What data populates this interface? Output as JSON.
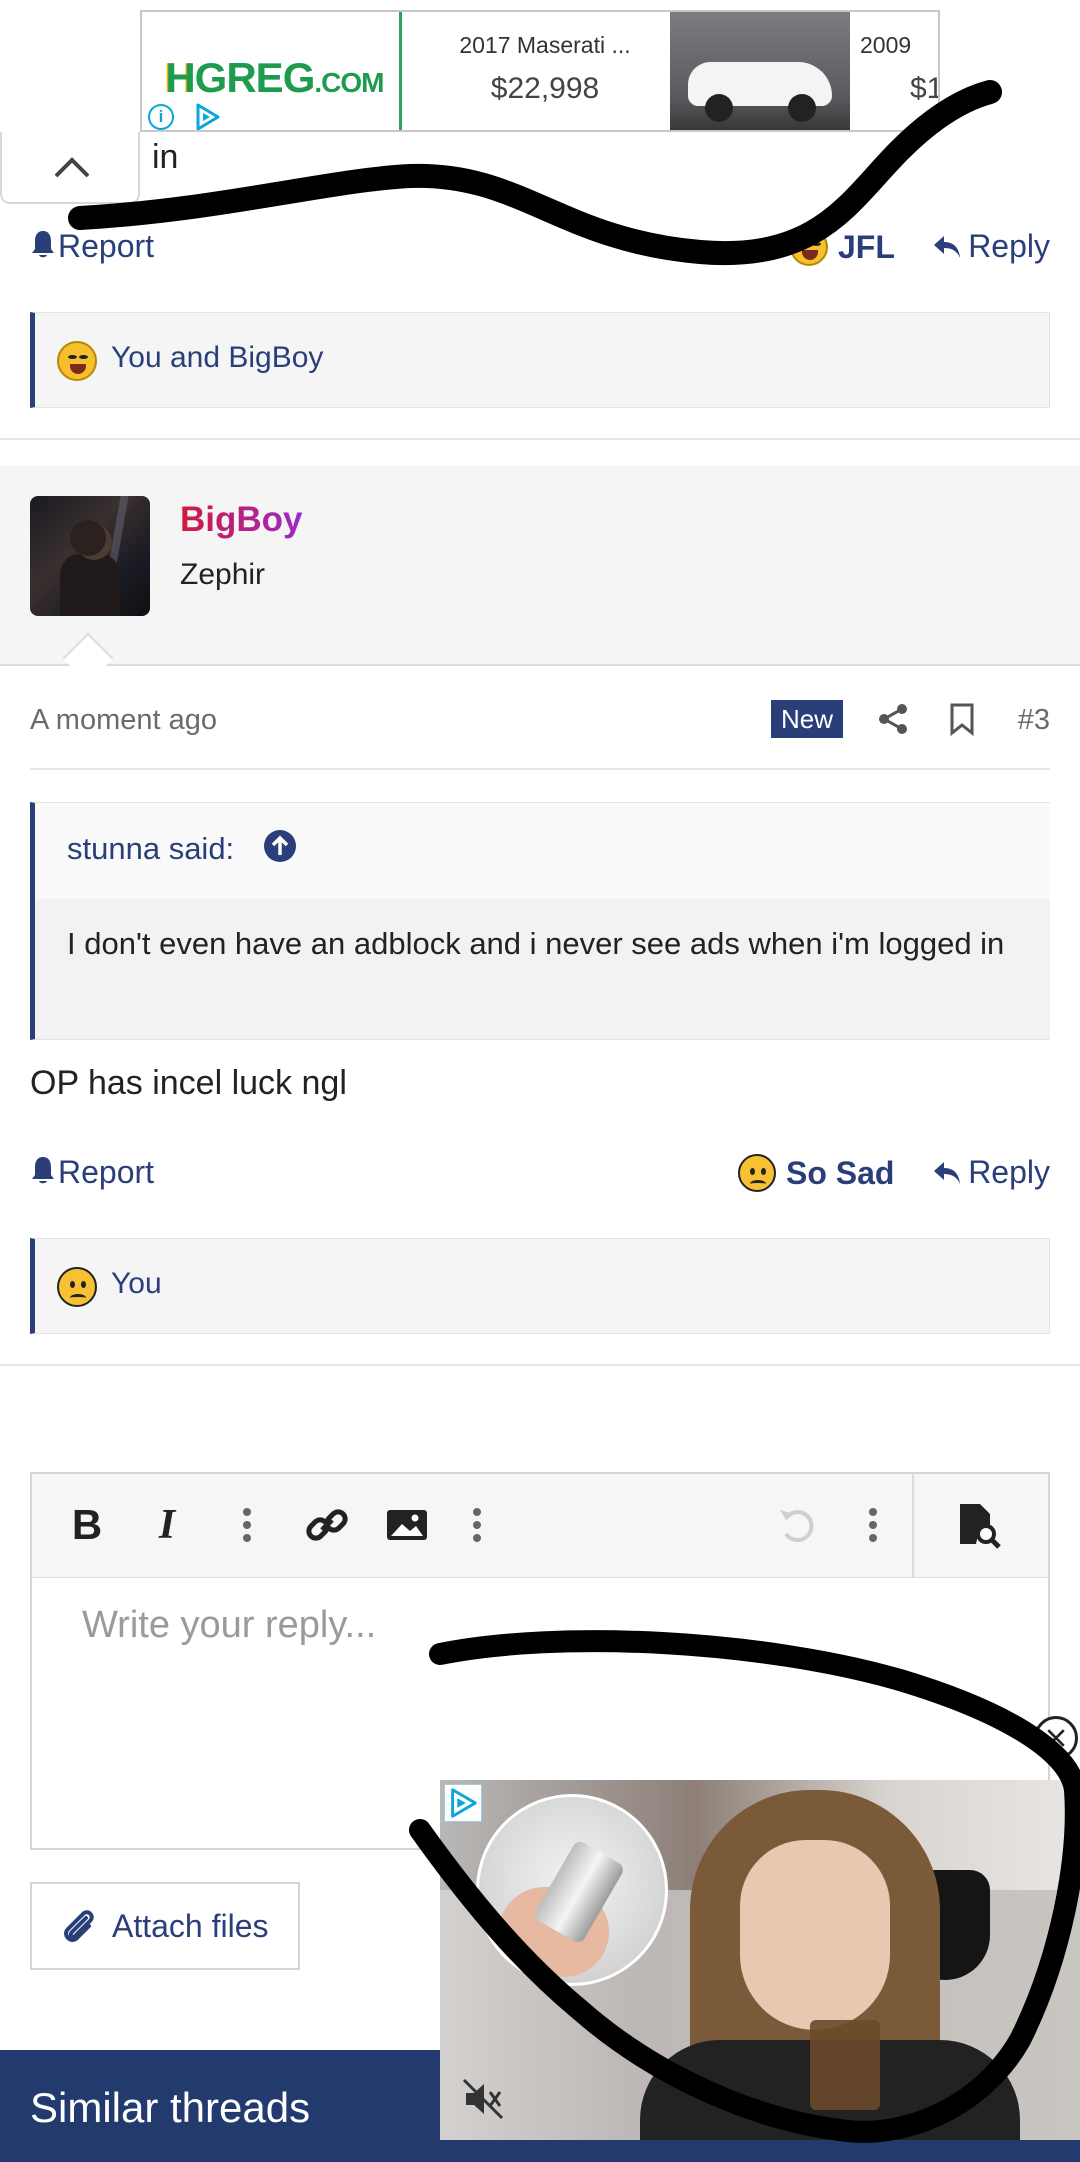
{
  "ad_banner": {
    "logo_brand": "HGREG",
    "logo_domain": ".COM",
    "card1_title": "2017 Maserati ...",
    "card1_price": "$22,998",
    "card2_title": "2009",
    "card2_price": "$1",
    "info_glyph": "i"
  },
  "previous_post": {
    "truncated_text": "in",
    "report_label": "Report",
    "reaction_label": "JFL",
    "reply_label": "Reply",
    "reactions_summary": "You and BigBoy"
  },
  "post": {
    "username": "BigBoy",
    "user_title": "Zephir",
    "timestamp": "A moment ago",
    "new_badge": "New",
    "post_number": "#3",
    "quote_author": "stunna said:",
    "quote_text": "I don't even have an adblock and i never see ads when i'm logged in",
    "body": "OP has incel luck ngl",
    "report_label": "Report",
    "reaction_label": "So Sad",
    "reply_label": "Reply",
    "reactions_summary": "You"
  },
  "editor": {
    "placeholder": "Write your reply...",
    "toolbar_icons": [
      "bold-icon",
      "italic-icon",
      "more-options-icon",
      "link-icon",
      "image-icon",
      "more-options-icon",
      "undo-icon",
      "more-options-icon",
      "preview-icon"
    ],
    "bold_glyph": "B",
    "italic_glyph": "I",
    "attach_label": "Attach files"
  },
  "similar_threads": {
    "title": "Similar threads"
  },
  "colors": {
    "accent": "#2a3f7a",
    "footer_bar": "#233a6e",
    "username_gradient_start": "#d01a3c",
    "username_gradient_end": "#9c29c7",
    "ad_logo_green": "#1e9c4e"
  }
}
